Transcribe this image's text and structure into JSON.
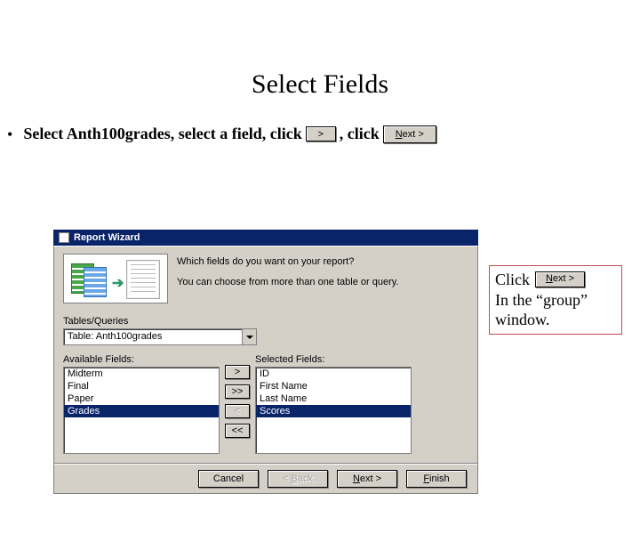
{
  "slide": {
    "title": "Select Fields",
    "bullet_pre": "Select Anth100grades, select a field, click",
    "bullet_mid": ", click",
    "arrow_btn": ">",
    "next_btn_letter": "N",
    "next_btn_rest": "ext >"
  },
  "note": {
    "click_label": "Click",
    "next_btn_letter": "N",
    "next_btn_rest": "ext >",
    "line2": "In the “group”",
    "line3": "window."
  },
  "wizard": {
    "title": "Report Wizard",
    "prompt_line1": "Which fields do you want on your report?",
    "prompt_line2": "You can choose from more than one table or query.",
    "tq_label": "Tables/Queries",
    "combo_value": "Table: Anth100grades",
    "avail_label": "Available Fields:",
    "sel_label": "Selected Fields:",
    "available": [
      "Midterm",
      "Final",
      "Paper",
      "Grades"
    ],
    "available_selected_index": 3,
    "selected": [
      "ID",
      "First Name",
      "Last Name",
      "Scores"
    ],
    "selected_selected_index": 3,
    "move_one": ">",
    "move_all": ">>",
    "back_one": "<",
    "back_all": "<<",
    "cancel": "Cancel",
    "back_label": "< ",
    "back_u": "B",
    "back_rest": "ack",
    "next_u": "N",
    "next_rest": "ext >",
    "finish_u": "F",
    "finish_rest": "inish"
  }
}
